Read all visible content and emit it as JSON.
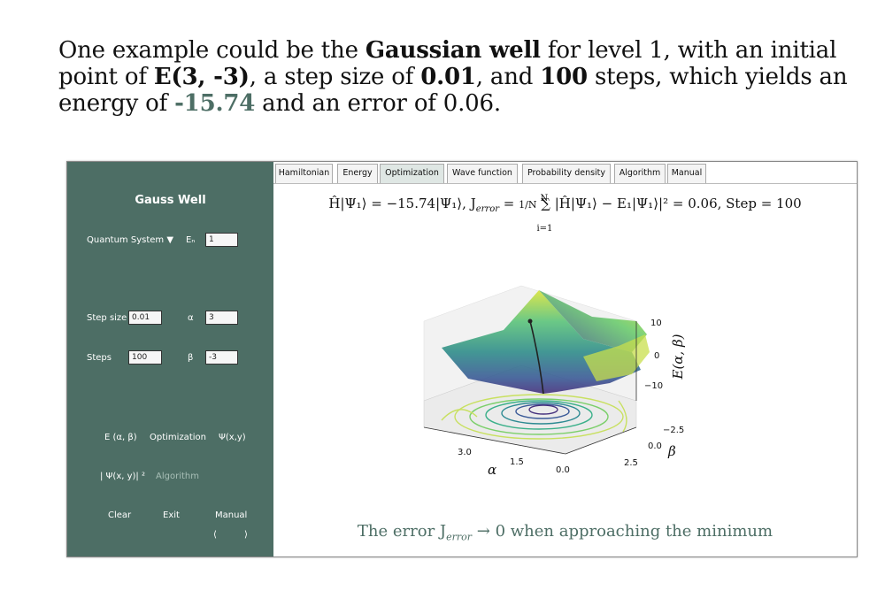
{
  "intro": {
    "t1": "One example could be the ",
    "b1": "Gaussian well",
    "t2": " for level 1, with an initial point of ",
    "b2": "E(3, -3)",
    "t3": ", a step size of ",
    "b3": "0.01",
    "t4": ", and ",
    "b4": "100",
    "t5": " steps, which yields an energy of ",
    "g1": "-15.74",
    "t6": " and an error of 0.06."
  },
  "sidebar": {
    "title": "Gauss Well",
    "quantum_system": "Quantum System ▼",
    "en_label": "Eₙ",
    "en_value": "1",
    "step_size_label": "Step size",
    "step_size_value": "0.01",
    "alpha_label": "α",
    "alpha_value": "3",
    "steps_label": "Steps",
    "steps_value": "100",
    "beta_label": "β",
    "beta_value": "-3",
    "btn_energy": "E (α, β)",
    "btn_optimization": "Optimization",
    "btn_psi": "Ψ(x,y)",
    "btn_prob": "| Ψ(x, y)| ²",
    "btn_algorithm": "Algorithm",
    "btn_clear": "Clear",
    "btn_exit": "Exit",
    "btn_manual": "Manual",
    "prev": "⟨",
    "next": "⟩"
  },
  "tabs": [
    "Hamiltonian",
    "Energy",
    "Optimization",
    "Wave function",
    "Probability density",
    "Algorithm",
    "Manual"
  ],
  "active_tab": "Optimization",
  "formula": {
    "part1": "Ĥ|Ψ₁⟩ = −15.74|Ψ₁⟩,   J",
    "sub_error": "error",
    "part2": " = ",
    "frac": "1/N",
    "part3": " ∑ |Ĥ|Ψ₁⟩ − E₁|Ψ₁⟩|² = 0.06,   Step = 100",
    "sum_top": "N",
    "sum_bottom": "i=1"
  },
  "caption": {
    "pre": "The error J",
    "sub": "error",
    "post": " → 0 when approaching the minimum"
  },
  "plot": {
    "z_ticks": [
      "10",
      "0",
      "−10"
    ],
    "z_label": "E(α, β)",
    "alpha_ticks": [
      "3.0",
      "1.5",
      "0.0"
    ],
    "alpha_label": "α",
    "beta_ticks": [
      "−2.5",
      "0.0",
      "2.5"
    ],
    "beta_label": "β"
  },
  "colors": {
    "accent": "#4d6e65",
    "surface_low": "#46317e",
    "surface_high": "#d9e43b"
  }
}
